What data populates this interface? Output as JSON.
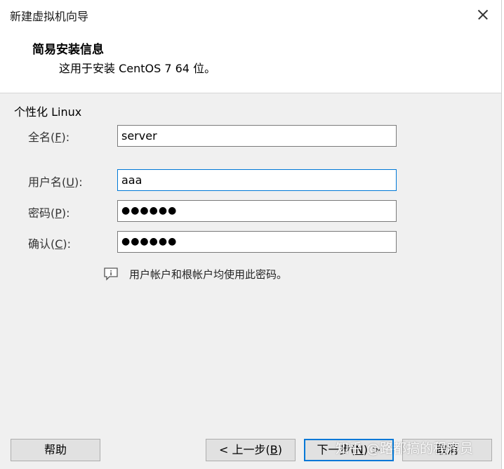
{
  "window": {
    "title": "新建虚拟机向导",
    "close_label": "×"
  },
  "header": {
    "title": "简易安装信息",
    "subtitle": "这用于安装 CentOS 7 64 位。"
  },
  "section": {
    "label": "个性化 Linux"
  },
  "fields": {
    "fullname": {
      "label_pre": "全名(",
      "label_key": "F",
      "label_post": "):",
      "value": "server"
    },
    "username": {
      "label_pre": "用户名(",
      "label_key": "U",
      "label_post": "):",
      "value": "aaa"
    },
    "password": {
      "label_pre": "密码(",
      "label_key": "P",
      "label_post": "):",
      "value": "●●●●●●"
    },
    "confirm": {
      "label_pre": "确认(",
      "label_key": "C",
      "label_post": "):",
      "value": "●●●●●●"
    }
  },
  "hint": {
    "icon": "info-speech-icon",
    "text": "用户帐户和根帐户均使用此密码。"
  },
  "buttons": {
    "help": "帮助",
    "back_pre": "< 上一步(",
    "back_key": "B",
    "back_post": ")",
    "next_pre": "下一步(",
    "next_key": "N",
    "next_post": ") >",
    "cancel": "取消"
  },
  "watermark": "知乎 @路都搞的程序员",
  "colors": {
    "focus_border": "#0078d7",
    "dialog_bg": "#f0f0f0"
  }
}
